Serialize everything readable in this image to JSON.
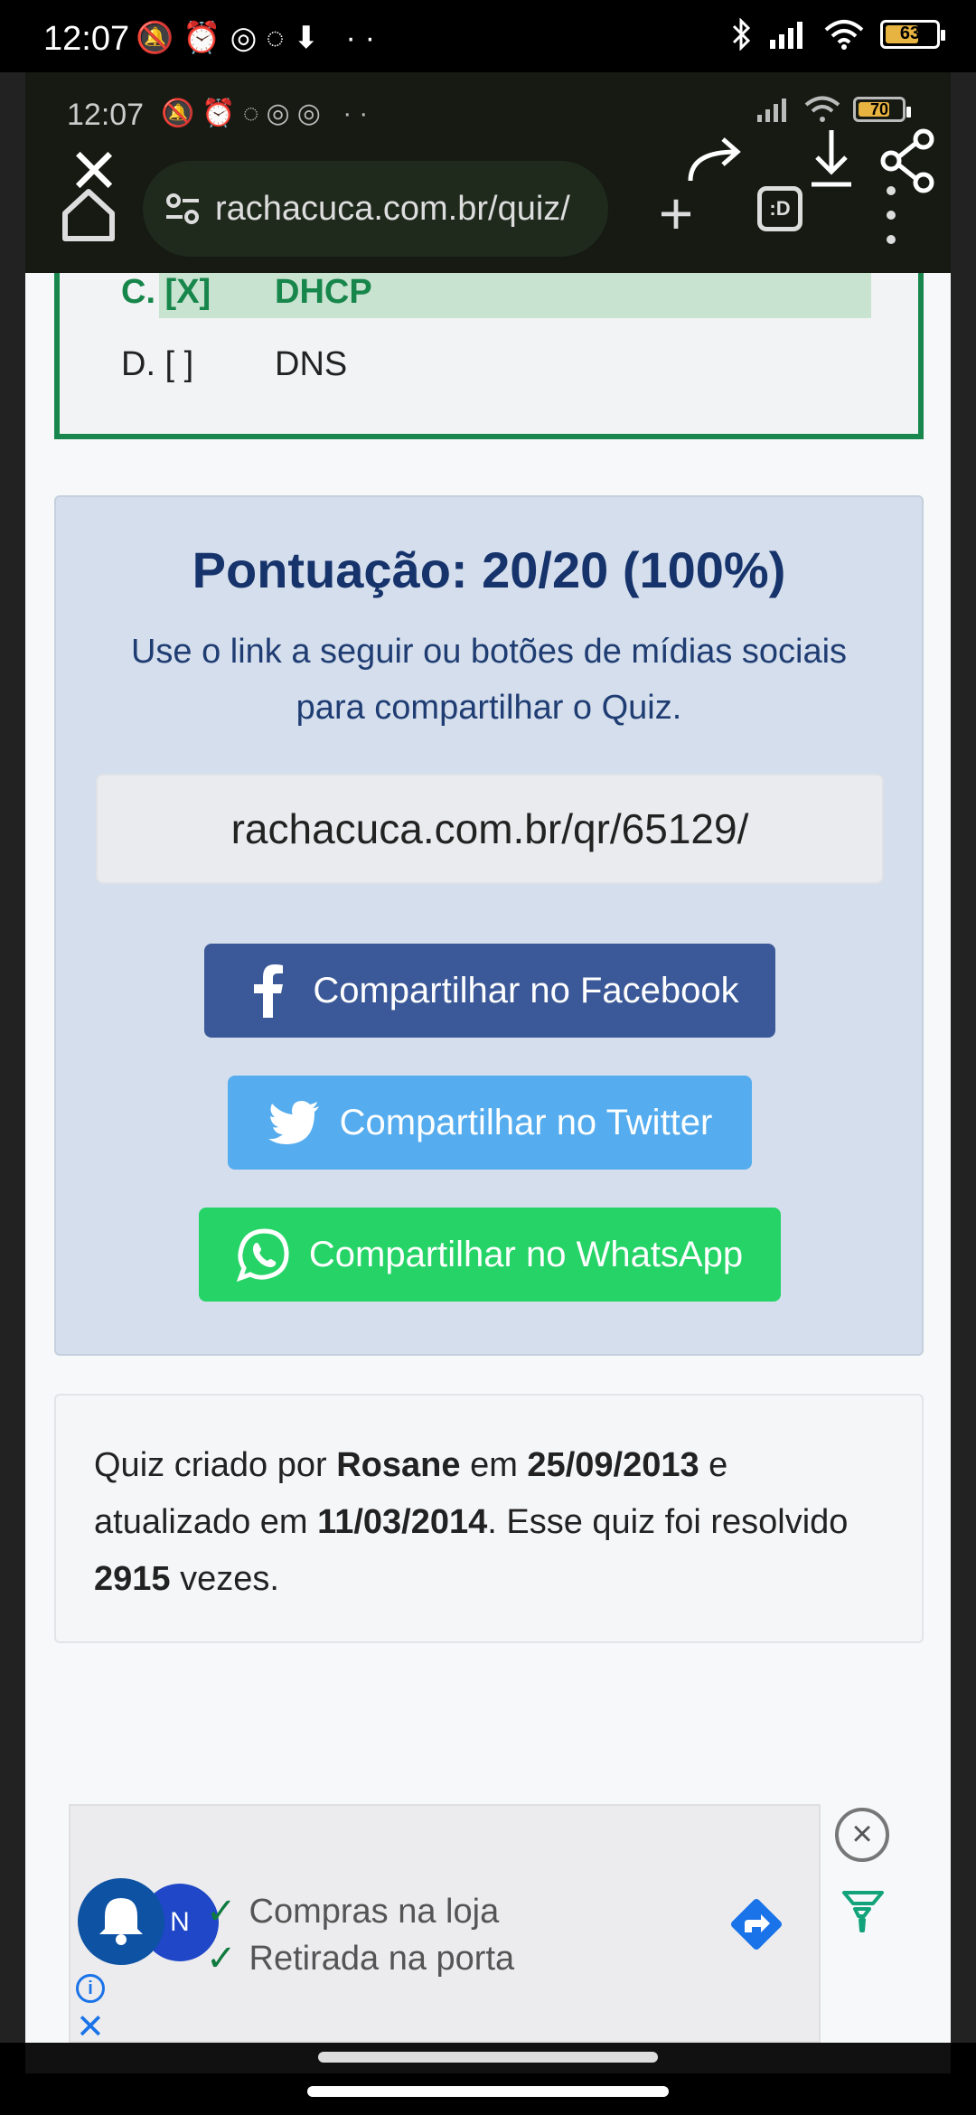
{
  "status_bar": {
    "time": "12:07",
    "left_icons": "🔕⏰◎◌⬇ ··",
    "battery": "63"
  },
  "inner_status_bar": {
    "time": "12:07",
    "left_icons": "🔕⏰◌◎◎ ··",
    "battery": "70"
  },
  "browser": {
    "url": "rachacuca.com.br/quiz/",
    "tabs_label": ":D",
    "plus": "+",
    "close": "×"
  },
  "quiz": {
    "answer_c_mark": "C. [X]",
    "answer_c_text": "DHCP",
    "answer_d_mark": "D. [  ]",
    "answer_d_text": "DNS"
  },
  "score": {
    "title": "Pontuação: 20/20 (100%)",
    "subtitle": "Use o link a seguir ou botões de mídias sociais para compartilhar o Quiz.",
    "share_url": "rachacuca.com.br/qr/65129/"
  },
  "share_buttons": {
    "facebook": "Compartilhar no Facebook",
    "twitter": "Compartilhar no Twitter",
    "whatsapp": "Compartilhar no WhatsApp"
  },
  "info": {
    "prefix": "Quiz criado por ",
    "author": "Rosane",
    "mid1": " em ",
    "created": "25/09/2013",
    "mid2": " e atualizado em ",
    "updated": "11/03/2014",
    "mid3": ". Esse quiz foi resolvido ",
    "count": "2915",
    "suffix": " vezes."
  },
  "ad": {
    "line1": "Compras na loja",
    "line2": "Retirada na porta",
    "badge": "N",
    "info_label": "i",
    "close_label": "×",
    "x_label": "✕"
  },
  "colors": {
    "accent_green": "#19874d",
    "facebook": "#3b5998",
    "twitter": "#55acee",
    "whatsapp": "#25d366",
    "score_title": "#16336b"
  }
}
